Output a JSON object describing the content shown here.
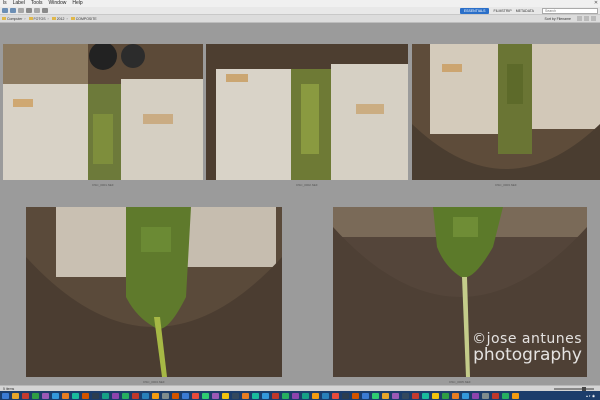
{
  "menu": {
    "items": [
      "ls",
      "Label",
      "Tools",
      "Window",
      "Help"
    ],
    "close": "✕"
  },
  "toolbar": {
    "workspace_active": "ESSENTIALS",
    "workspace_2": "FILMSTRIP",
    "workspace_3": "METADATA",
    "search_placeholder": "Search"
  },
  "pathbar": {
    "crumbs": [
      "Computer",
      "FOTOS",
      "2012",
      "COMPOSITE"
    ],
    "sort_label": "Sort by Filename"
  },
  "thumbnails": [
    {
      "caption": "DSC_0001.NEF"
    },
    {
      "caption": "DSC_0002.NEF"
    },
    {
      "caption": "DSC_0003.NEF"
    },
    {
      "caption": "DSC_0004.NEF"
    },
    {
      "caption": "DSC_0005.NEF"
    }
  ],
  "watermark": {
    "line1": "©jose antunes",
    "line2": "photography"
  },
  "status": {
    "text": "5 items"
  },
  "colors": {
    "accent": "#2a6fc9",
    "taskbar": "#1c3d6b"
  }
}
